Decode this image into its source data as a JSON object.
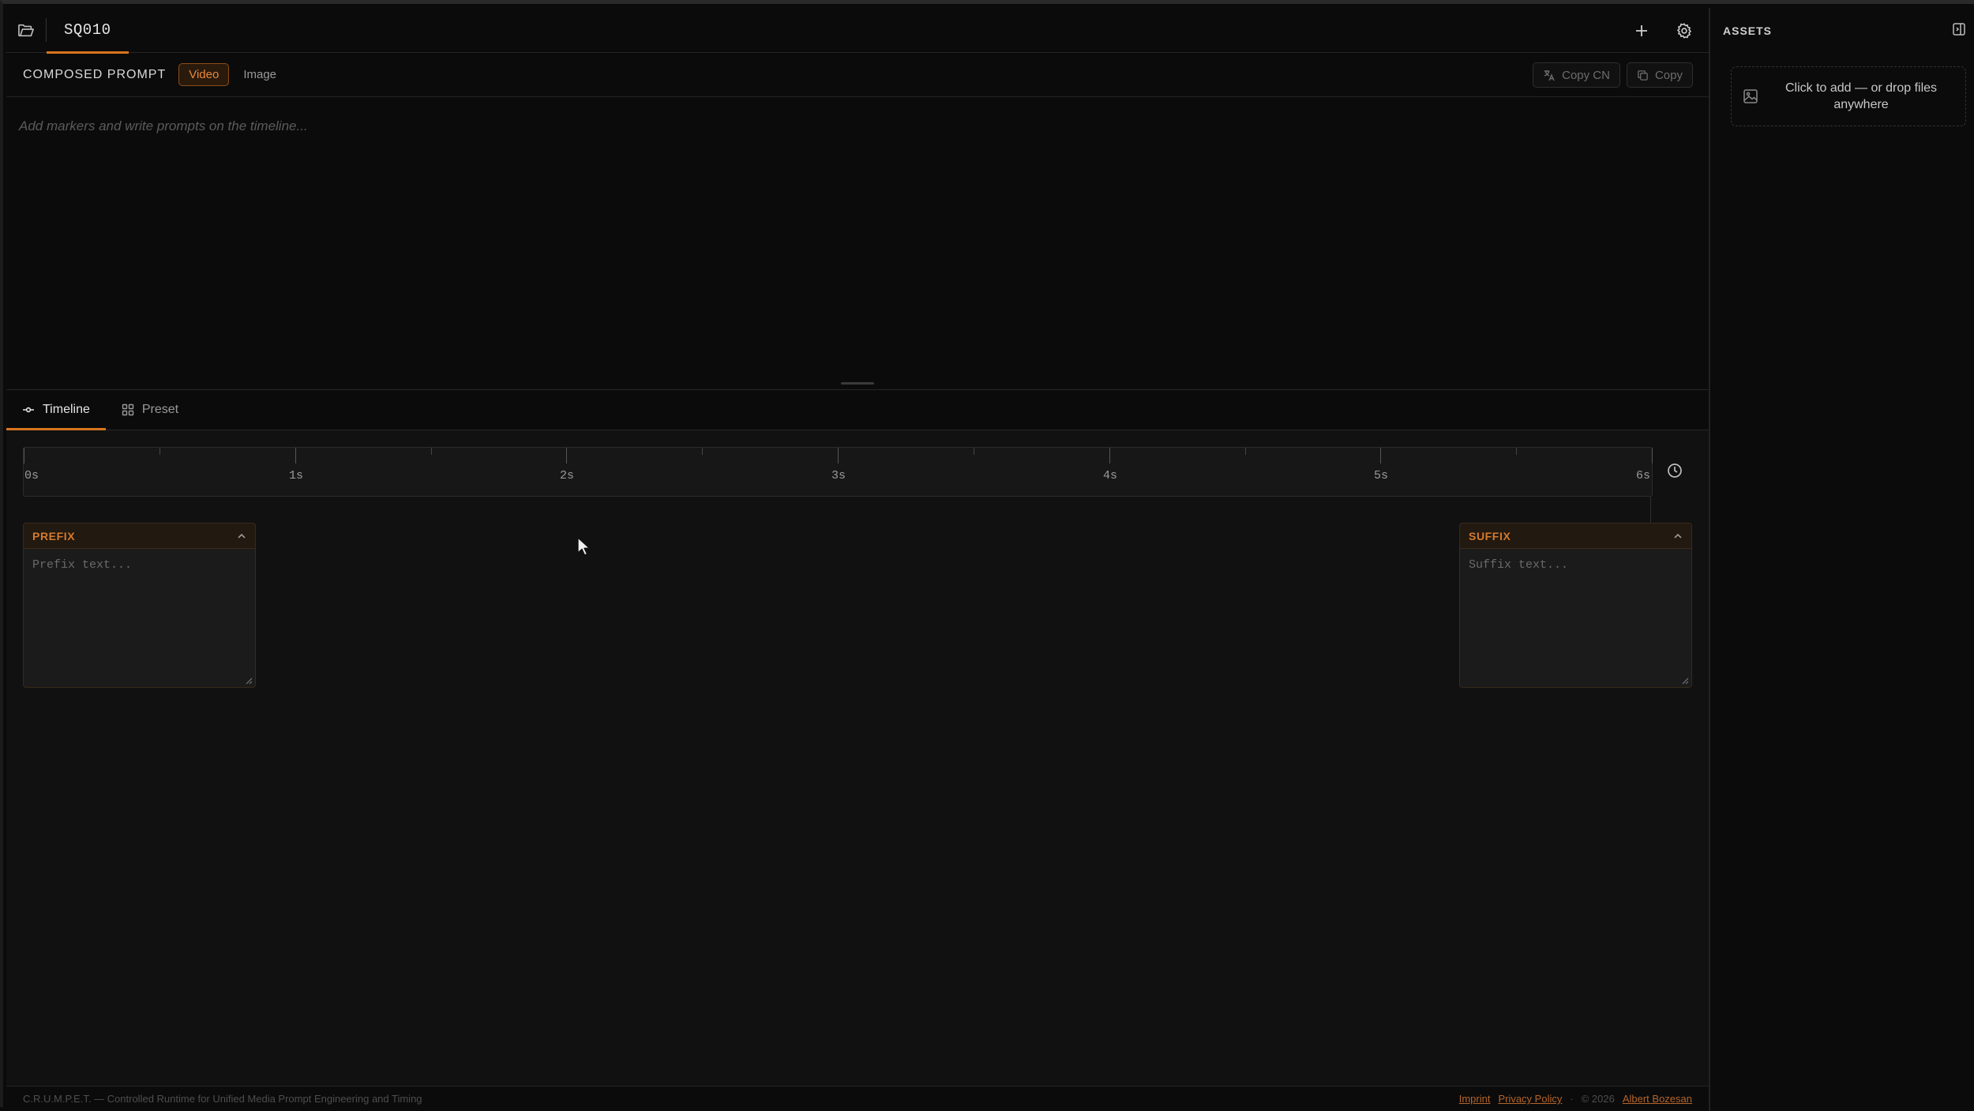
{
  "topbar": {
    "sequence_tab": "SQ010",
    "icons": {
      "folder": "folder-open-icon",
      "add": "plus-icon",
      "settings": "gear-icon"
    }
  },
  "prompt": {
    "title": "COMPOSED PROMPT",
    "modes": [
      "Video",
      "Image"
    ],
    "active_mode": "Video",
    "copy_cn_label": "Copy CN",
    "copy_label": "Copy",
    "placeholder": "Add markers and write prompts on the timeline..."
  },
  "tabs": {
    "timeline": "Timeline",
    "preset": "Preset",
    "active": "Timeline"
  },
  "timeline": {
    "ticks": [
      "0s",
      "1s",
      "2s",
      "3s",
      "4s",
      "5s",
      "6s"
    ],
    "duration_seconds": 6
  },
  "prefix": {
    "title": "PREFIX",
    "placeholder": "Prefix text..."
  },
  "suffix": {
    "title": "SUFFIX",
    "placeholder": "Suffix text..."
  },
  "footer": {
    "tagline": "C.R.U.M.P.E.T. — Controlled Runtime for Unified Media Prompt Engineering and Timing",
    "imprint": "Imprint",
    "privacy": "Privacy Policy",
    "separator": "·",
    "copyright": "© 2026",
    "author": "Albert Bozesan"
  },
  "assets": {
    "title": "ASSETS",
    "drop_text": "Click to add — or drop files anywhere"
  },
  "colors": {
    "accent": "#d9741e",
    "background": "#0b0b0b",
    "panel": "#111111"
  }
}
